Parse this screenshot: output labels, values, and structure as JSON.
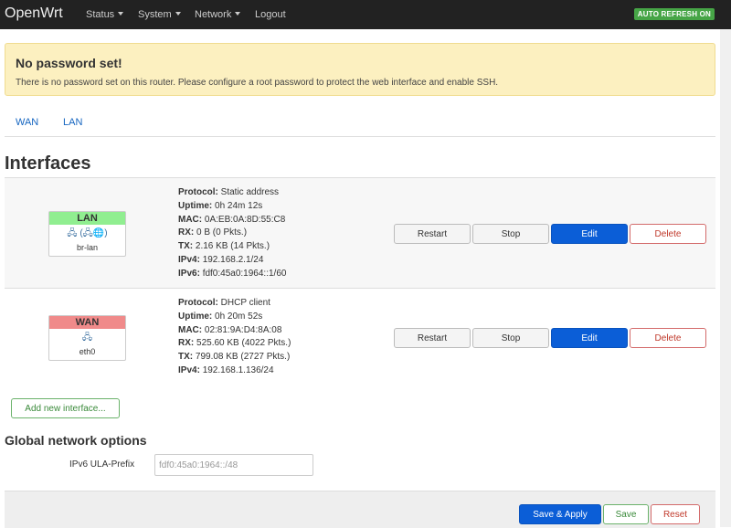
{
  "navbar": {
    "brand": "OpenWrt",
    "menus": [
      "Status",
      "System",
      "Network"
    ],
    "logout": "Logout",
    "auto_refresh": "AUTO REFRESH ON"
  },
  "alert": {
    "title": "No password set!",
    "text": "There is no password set on this router. Please configure a root password to protect the web interface and enable SSH."
  },
  "tabs": [
    "WAN",
    "LAN"
  ],
  "interfaces_title": "Interfaces",
  "interfaces": [
    {
      "name": "LAN",
      "icons": "🖧 (🖧🌐)",
      "device": "br-lan",
      "labels": [
        "Protocol:",
        "Uptime:",
        "MAC:",
        "RX:",
        "TX:",
        "IPv4:",
        "IPv6:"
      ],
      "values": [
        "Static address",
        "0h 24m 12s",
        "0A:EB:0A:8D:55:C8",
        "0 B (0 Pkts.)",
        "2.16 KB (14 Pkts.)",
        "192.168.2.1/24",
        "fdf0:45a0:1964::1/60"
      ]
    },
    {
      "name": "WAN",
      "icons": "🖧",
      "device": "eth0",
      "labels": [
        "Protocol:",
        "Uptime:",
        "MAC:",
        "RX:",
        "TX:",
        "IPv4:"
      ],
      "values": [
        "DHCP client",
        "0h 20m 52s",
        "02:81:9A:D4:8A:08",
        "525.60 KB (4022 Pkts.)",
        "799.08 KB (2727 Pkts.)",
        "192.168.1.136/24"
      ]
    }
  ],
  "row_buttons": {
    "restart": "Restart",
    "stop": "Stop",
    "edit": "Edit",
    "delete": "Delete"
  },
  "add_interface_label": "Add new interface...",
  "global": {
    "title": "Global network options",
    "ula_label": "IPv6 ULA-Prefix",
    "ula_value": "fdf0:45a0:1964::/48"
  },
  "footer": {
    "save_apply": "Save & Apply",
    "save": "Save",
    "reset": "Reset"
  },
  "colors": {
    "navbar": "#222222",
    "alert_bg": "#fcf0c0",
    "lan_header": "#90ee90",
    "wan_header": "#f08a8a",
    "primary": "#0b5ed7",
    "auto_refresh": "#46a546"
  }
}
